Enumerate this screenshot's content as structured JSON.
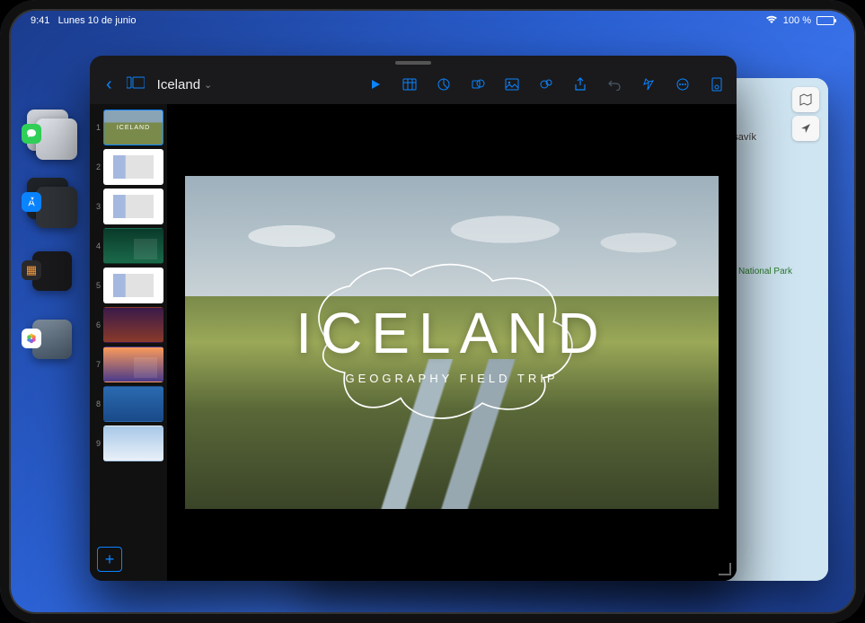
{
  "statusbar": {
    "time": "9:41",
    "date": "Lunes 10 de junio",
    "battery_pct": "100 %"
  },
  "stage_rail": {
    "piles": [
      {
        "badge_app": "messages",
        "badge_color": "#30d158"
      },
      {
        "badge_app": "appstore",
        "badge_color": "#0a84ff"
      },
      {
        "badge_app": "calculator",
        "badge_color": "#333333"
      },
      {
        "badge_app": "photos",
        "badge_color": "#ffffff"
      }
    ]
  },
  "maps": {
    "labels": {
      "husavik": "Húsavík",
      "park": "Vatnajökull National Park"
    },
    "buttons": {
      "map_mode": "map-icon",
      "locate": "location-icon"
    }
  },
  "keynote": {
    "doc_title": "Iceland",
    "toolbar_icons": [
      "play-icon",
      "table-icon",
      "chart-icon",
      "shape-icon",
      "image-icon",
      "comment-icon",
      "share-icon",
      "undo-icon",
      "animate-icon",
      "more-icon",
      "document-icon"
    ],
    "slide": {
      "title": "ICELAND",
      "subtitle": "GEOGRAPHY FIELD TRIP"
    },
    "thumbs": [
      {
        "n": "1",
        "cls": "th1",
        "selected": true
      },
      {
        "n": "2",
        "cls": "th2",
        "selected": false
      },
      {
        "n": "3",
        "cls": "th3",
        "selected": false
      },
      {
        "n": "4",
        "cls": "th4",
        "selected": false
      },
      {
        "n": "5",
        "cls": "th5",
        "selected": false
      },
      {
        "n": "6",
        "cls": "th6",
        "selected": false
      },
      {
        "n": "7",
        "cls": "th7",
        "selected": false
      },
      {
        "n": "8",
        "cls": "th8",
        "selected": false
      },
      {
        "n": "9",
        "cls": "th9",
        "selected": false
      }
    ],
    "add_label": "+"
  }
}
